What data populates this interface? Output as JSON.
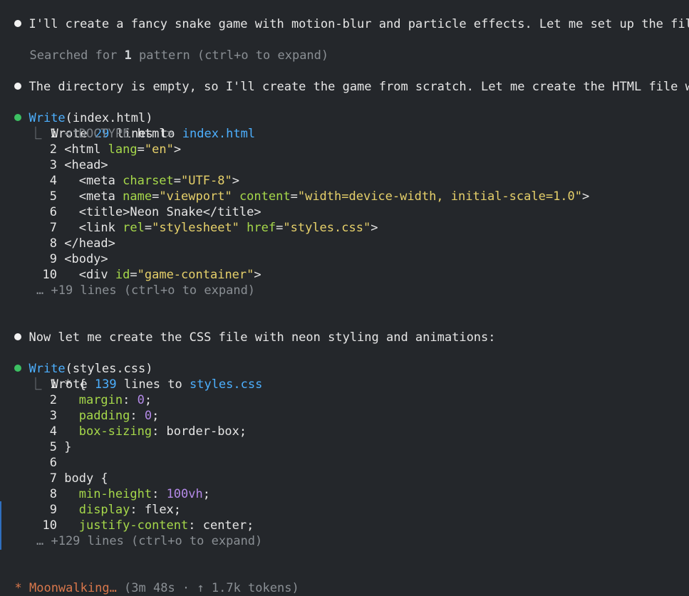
{
  "messages": {
    "m1": "I'll create a fancy snake game with motion-blur and particle effects. Let me set up the files.",
    "search_prefix": "Searched for ",
    "search_count": "1",
    "search_suffix": " pattern (ctrl+o to expand)",
    "m2": "The directory is empty, so I'll create the game from scratch. Let me create the HTML file with",
    "m3": "Now let me create the CSS file with neon styling and animations:"
  },
  "tool1": {
    "name": "Write",
    "arg": "(index.html)",
    "result_prefix": "Wrote ",
    "result_count": "29",
    "result_mid": " lines to ",
    "result_file": "index.html",
    "more": "… +19 lines (ctrl+o to expand)"
  },
  "tool2": {
    "name": "Write",
    "arg": "(styles.css)",
    "result_prefix": "Wrote ",
    "result_count": "139",
    "result_mid": " lines to ",
    "result_file": "styles.css",
    "more": "… +129 lines (ctrl+o to expand)"
  },
  "status": {
    "glyph": "*",
    "label": "Moonwalking…",
    "detail": " (3m 48s · ↑ 1.7k tokens)"
  },
  "colors": {
    "background": "#24272b",
    "bullet_green": "#3cc062",
    "tool_blue": "#4db0ff",
    "attr_green": "#a6d84a",
    "string_yellow": "#e6d06a",
    "number_purple": "#b48ae8",
    "status_orange": "#d9774b"
  }
}
